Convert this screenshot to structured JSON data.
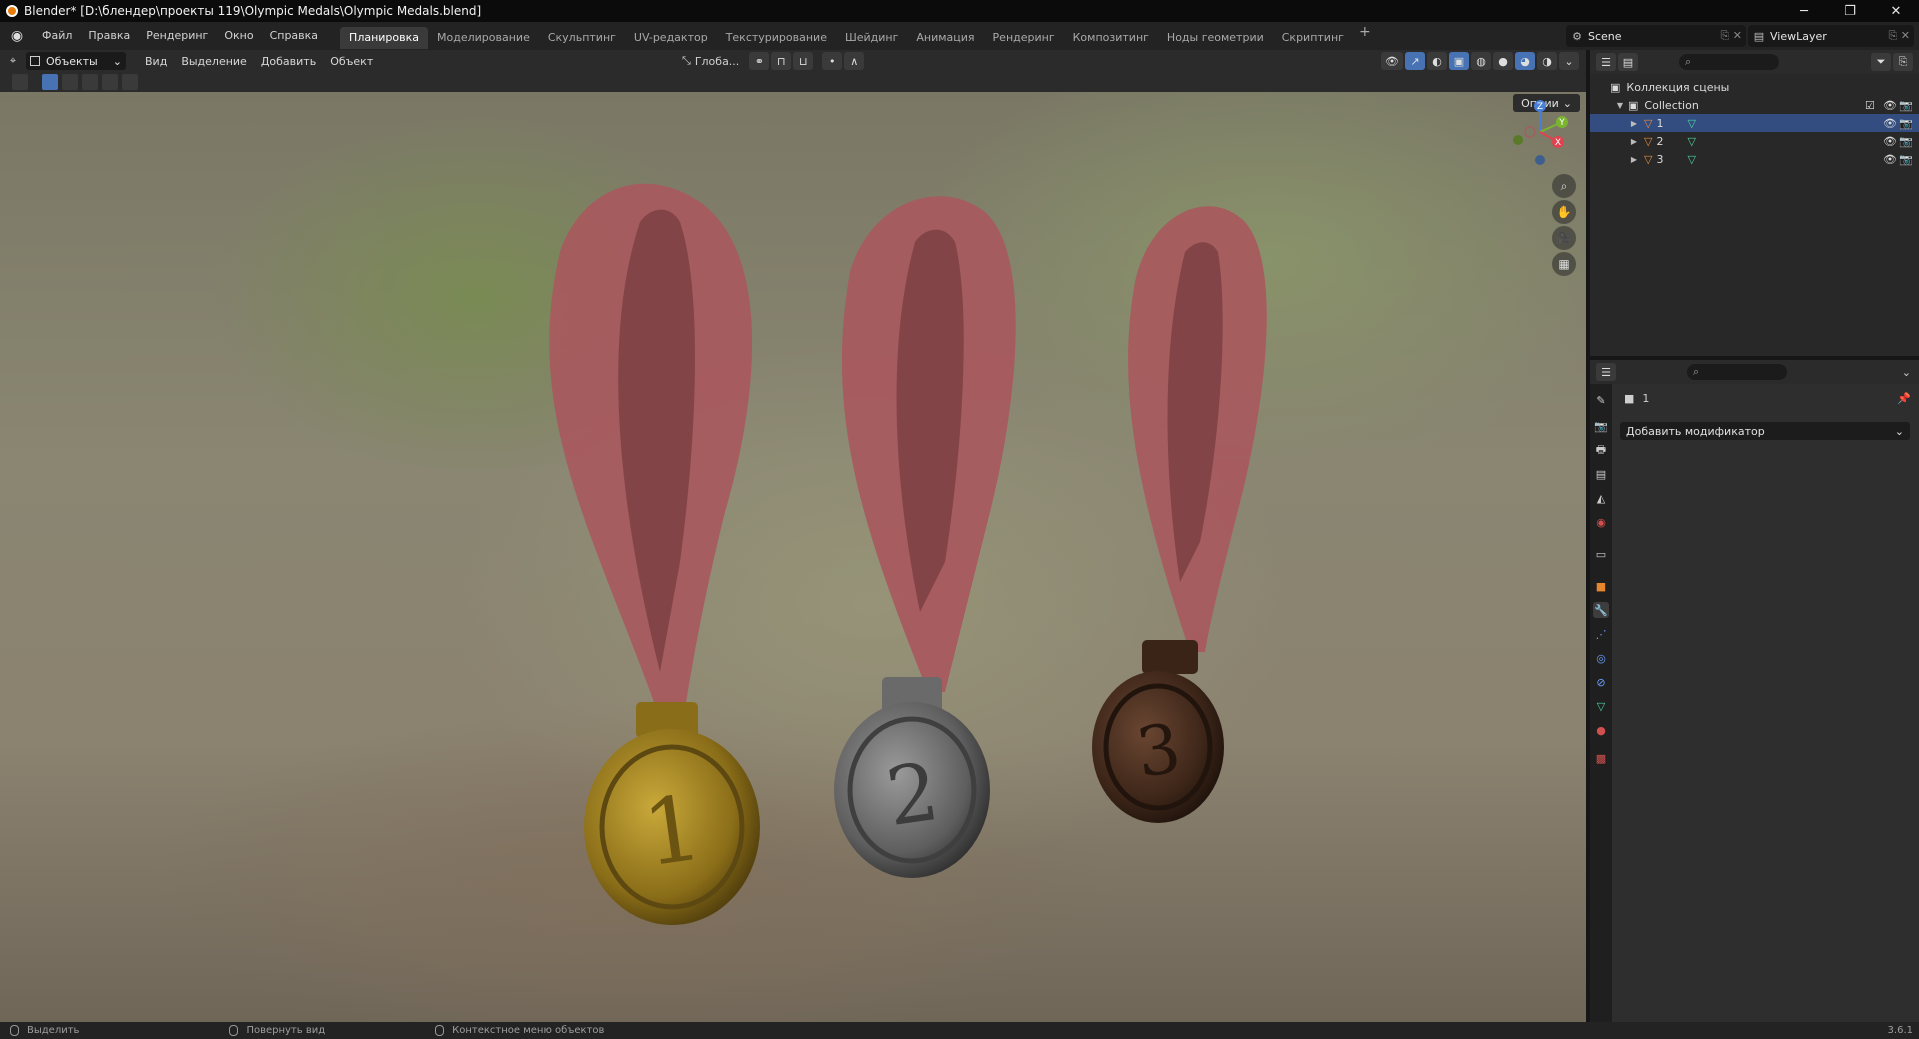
{
  "window": {
    "title": "Blender* [D:\\блендер\\проекты 119\\Olympic Medals\\Olympic Medals.blend]",
    "buttons": {
      "minimize": "─",
      "restore": "❐",
      "close": "✕"
    }
  },
  "menu": {
    "items": [
      "Файл",
      "Правка",
      "Рендеринг",
      "Окно",
      "Справка"
    ]
  },
  "workspaces": {
    "tabs": [
      "Планировка",
      "Моделирование",
      "Скульптинг",
      "UV-редактор",
      "Текстурирование",
      "Шейдинг",
      "Анимация",
      "Рендеринг",
      "Композитинг",
      "Ноды геометрии",
      "Скриптинг"
    ],
    "active": "Планировка",
    "add": "+"
  },
  "scene": {
    "name": "Scene"
  },
  "view_layer": {
    "name": "ViewLayer"
  },
  "viewport_header": {
    "mode": "Объекты",
    "menus": [
      "Вид",
      "Выделение",
      "Добавить",
      "Объект"
    ],
    "transform_orientation": "Глоба..."
  },
  "viewport": {
    "options": "Опции",
    "gizmo_axes": {
      "z": "Z",
      "y": "Y",
      "x": "X"
    }
  },
  "outliner": {
    "root": "Коллекция сцены",
    "collection": "Collection",
    "objects": [
      {
        "name": "1",
        "selected": true
      },
      {
        "name": "2",
        "selected": false
      },
      {
        "name": "3",
        "selected": false
      }
    ]
  },
  "properties": {
    "object_name": "1",
    "add_modifier": "Добавить модификатор"
  },
  "status": {
    "select": "Выделить",
    "rotate": "Повернуть вид",
    "context_menu": "Контекстное меню объектов",
    "version": "3.6.1"
  },
  "colors": {
    "accent": "#4772b3",
    "selection": "#334d80",
    "gold": "#b8952a",
    "silver": "#8a8a8a",
    "bronze": "#5a3a28",
    "ribbon": "#a85a5e"
  }
}
